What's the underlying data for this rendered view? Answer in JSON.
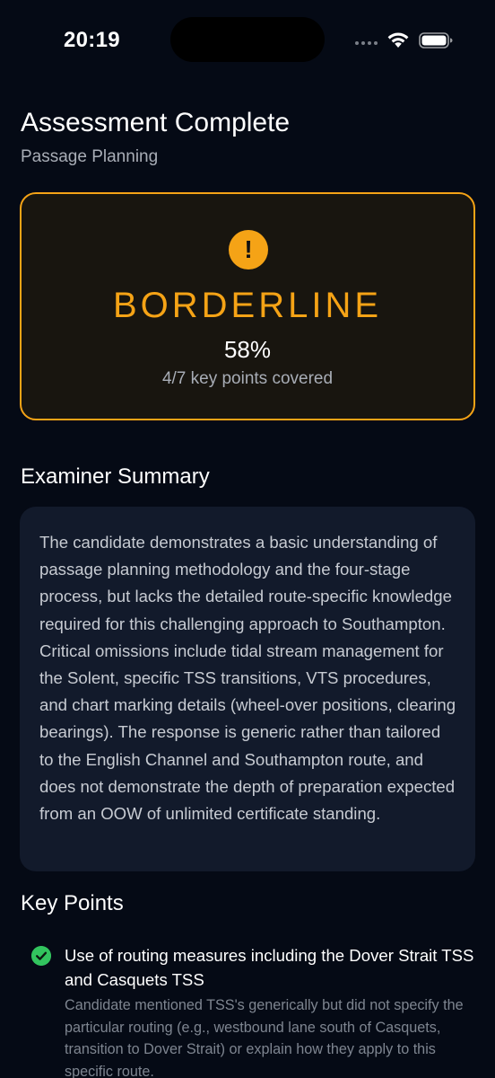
{
  "status_bar": {
    "time": "20:19"
  },
  "header": {
    "title": "Assessment Complete",
    "subtitle": "Passage Planning"
  },
  "result": {
    "icon": "exclamation-icon",
    "verdict": "BORDERLINE",
    "score": "58%",
    "coverage": "4/7 key points covered",
    "accent_color": "#f5a316"
  },
  "summary": {
    "heading": "Examiner Summary",
    "text": "The candidate demonstrates a basic understanding of passage planning methodology and the four-stage process, but lacks the detailed route-specific knowledge required for this challenging approach to Southampton. Critical omissions include tidal stream management for the Solent, specific TSS transitions, VTS procedures, and chart marking details (wheel-over positions, clearing bearings). The response is generic rather than tailored to the English Channel and Southampton route, and does not demonstrate the depth of preparation expected from an OOW of unlimited certificate standing."
  },
  "key_points": {
    "heading": "Key Points",
    "items": [
      {
        "status_icon": "check-circle-icon",
        "status_color": "#32c45e",
        "title": "Use of routing measures including the Dover Strait TSS and Casquets TSS",
        "detail": "Candidate mentioned TSS's generically but did not specify the particular routing (e.g., westbound lane south of Casquets, transition to Dover Strait) or explain how they apply to this specific route."
      }
    ]
  }
}
